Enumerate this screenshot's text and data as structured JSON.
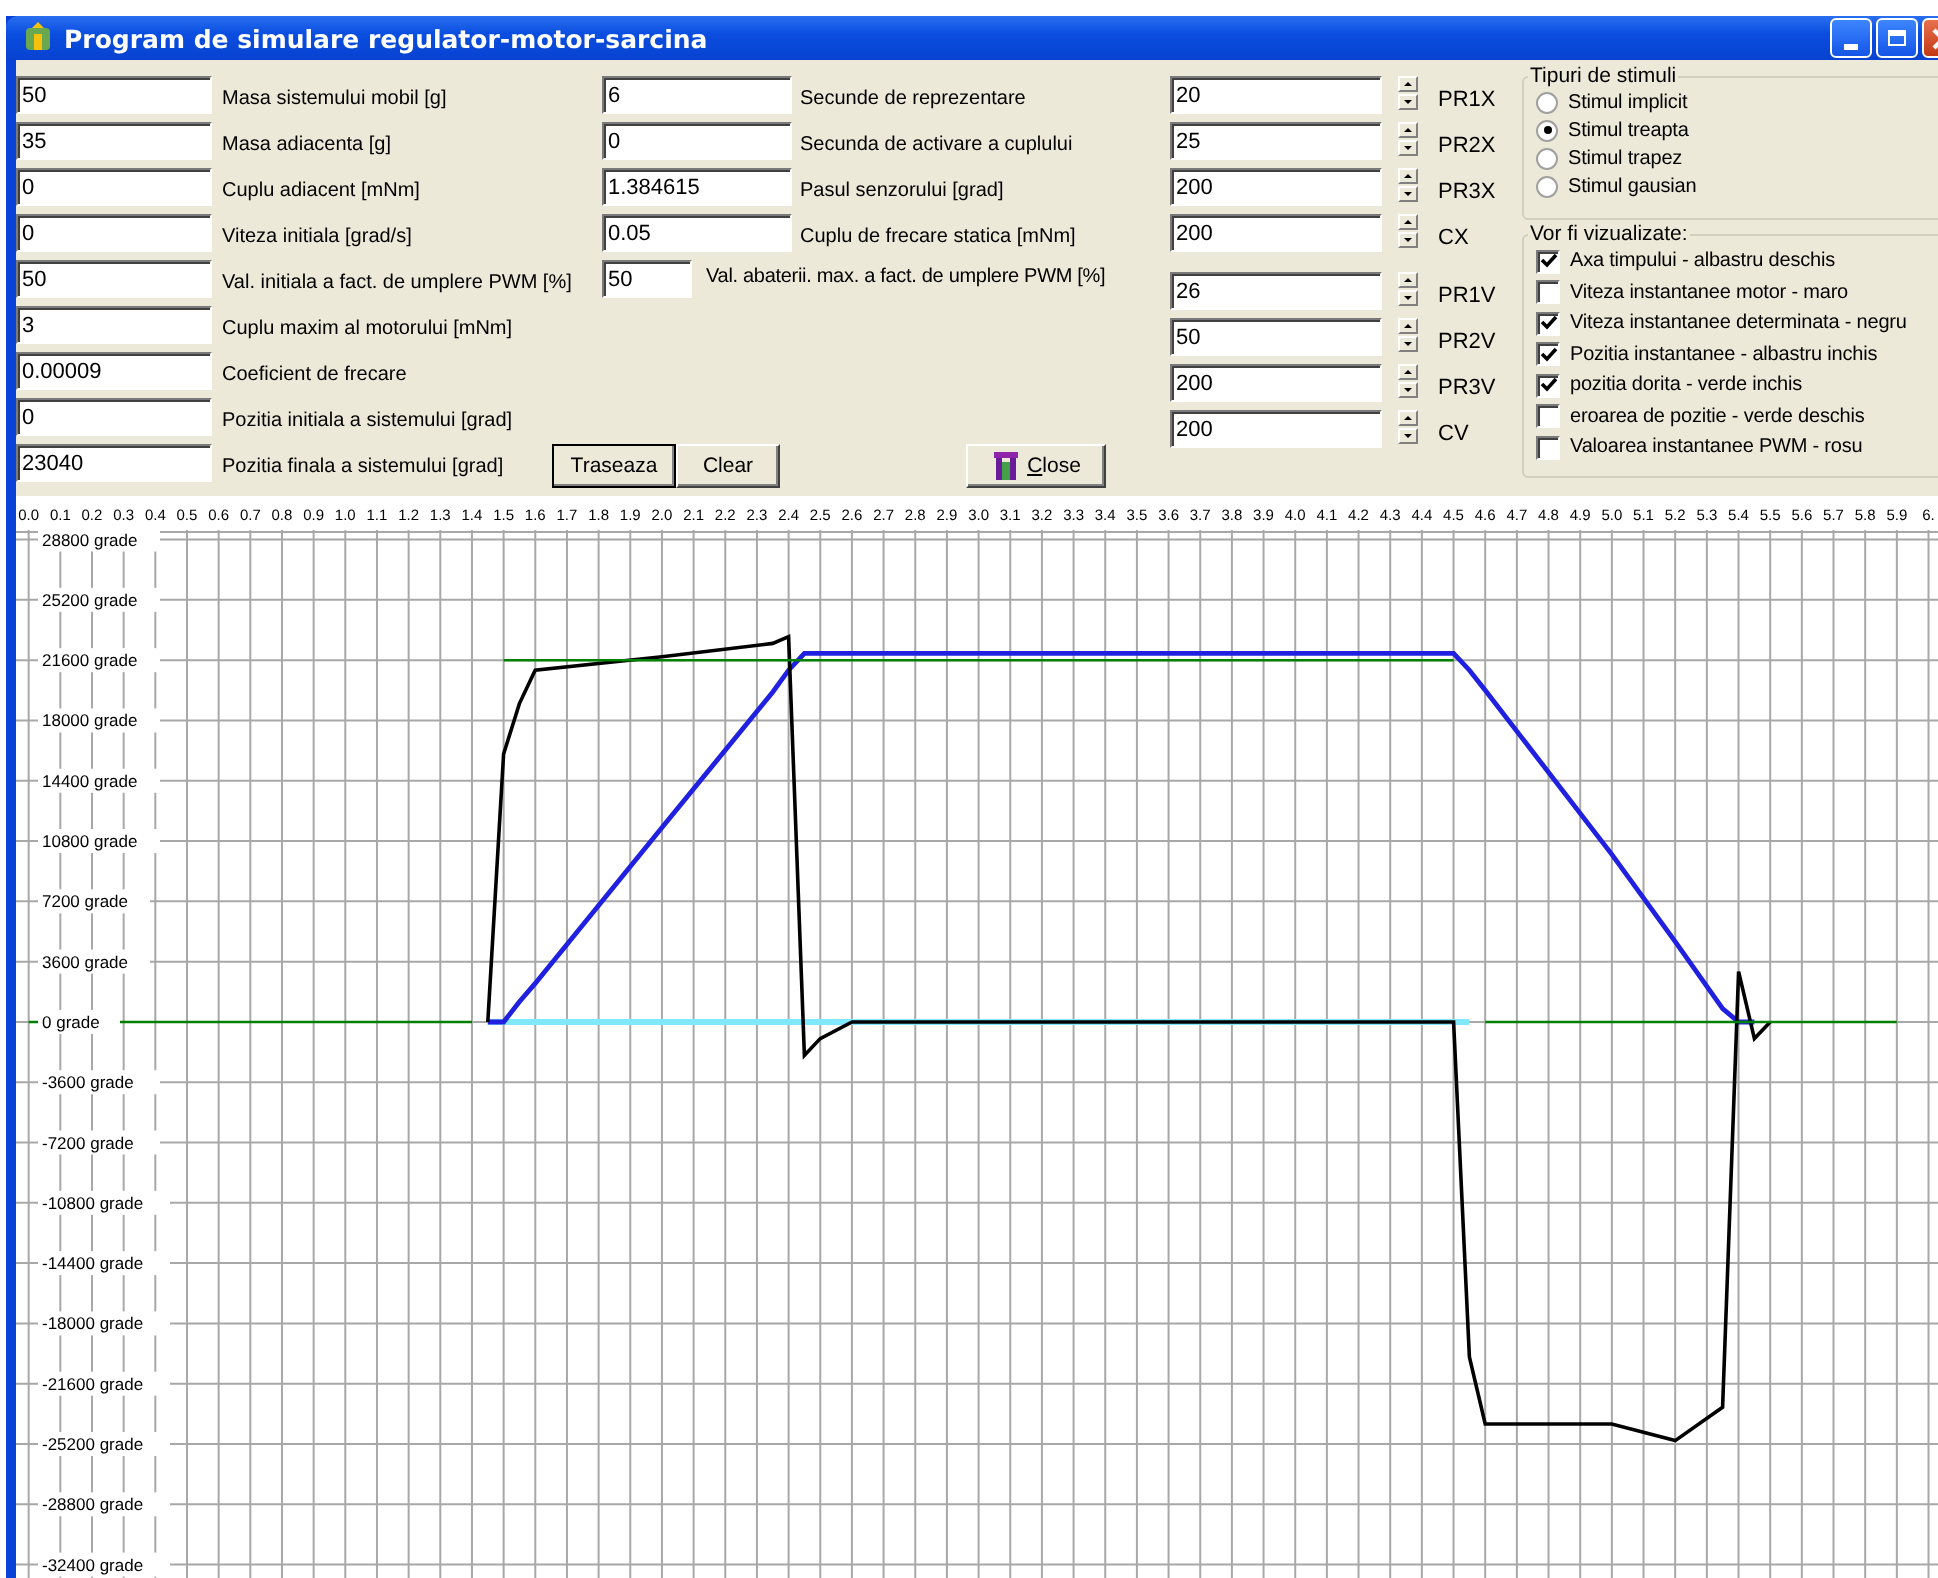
{
  "window": {
    "title": "Program de simulare regulator-motor-sarcina"
  },
  "parameters": [
    {
      "value": "50",
      "label": "Masa sistemului mobil [g]"
    },
    {
      "value": "35",
      "label": "Masa adiacenta [g]"
    },
    {
      "value": "0",
      "label": "Cuplu adiacent [mNm]"
    },
    {
      "value": "0",
      "label": "Viteza initiala [grad/s]"
    },
    {
      "value": "50",
      "label": "Val. initiala a fact. de umplere PWM [%]"
    },
    {
      "value": "3",
      "label": "Cuplu maxim al motorului [mNm]"
    },
    {
      "value": "0.00009",
      "label": "Coeficient de frecare"
    },
    {
      "value": "0",
      "label": "Pozitia initiala a sistemului [grad]"
    },
    {
      "value": "23040",
      "label": "Pozitia finala a sistemului [grad]"
    }
  ],
  "parameters_2": [
    {
      "kind": "wide",
      "value": "6",
      "label": "Secunde de reprezentare"
    },
    {
      "kind": "wide",
      "value": "0",
      "label": "Secunda de activare a cuplului"
    },
    {
      "kind": "wide",
      "value": "1.384615",
      "label": "Pasul senzorului [grad]"
    },
    {
      "kind": "wide",
      "value": "0.05",
      "label": "Cuplu de frecare statica [mNm]"
    },
    {
      "kind": "narrow",
      "value": "50",
      "label": "Val. abaterii. max. a fact. de umplere PWM [%]"
    }
  ],
  "buttons": [
    {
      "label": "Traseaza",
      "focused": true
    },
    {
      "label": "Clear",
      "focused": false
    }
  ],
  "close_button": {
    "label": "Close"
  },
  "position_tuning": [
    {
      "value": "20",
      "label": "PR1X"
    },
    {
      "value": "25",
      "label": "PR2X"
    },
    {
      "value": "200",
      "label": "PR3X"
    },
    {
      "value": "200",
      "label": "CX"
    }
  ],
  "velocity_tuning": [
    {
      "value": "26",
      "label": "PR1V"
    },
    {
      "value": "50",
      "label": "PR2V"
    },
    {
      "value": "200",
      "label": "PR3V"
    },
    {
      "value": "200",
      "label": "CV"
    }
  ],
  "stimulus_types": {
    "title": "Tipuri de stimuli",
    "options": [
      {
        "label": "Stimul implicit",
        "selected": false
      },
      {
        "label": "Stimul treapta",
        "selected": true
      },
      {
        "label": "Stimul trapez",
        "selected": false
      },
      {
        "label": "Stimul gausian",
        "selected": false
      }
    ]
  },
  "display": {
    "title": "Vor fi vizualizate:",
    "options": [
      {
        "label": "Axa timpului - albastru deschis",
        "checked": true
      },
      {
        "label": "Viteza instantanee motor - maro",
        "checked": false
      },
      {
        "label": "Viteza instantanee determinata - negru",
        "checked": true
      },
      {
        "label": "Pozitia instantanee - albastru inchis",
        "checked": true
      },
      {
        "label": "pozitia dorita - verde inchis",
        "checked": true
      },
      {
        "label": "eroarea de pozitie - verde deschis",
        "checked": false
      },
      {
        "label": "Valoarea instantanee PWM - rosu",
        "checked": false
      }
    ]
  },
  "plot": {
    "chart_data": {
      "type": "line",
      "x": [
        0,
        1.4,
        1.45,
        1.5,
        1.55,
        1.6,
        2.0,
        2.35,
        2.4,
        2.45,
        2.5,
        2.6,
        4.4,
        4.5,
        4.55,
        4.6,
        5.0,
        5.2,
        5.35,
        5.4,
        5.45,
        5.5,
        5.9
      ],
      "xlim": [
        -0.04,
        6.03
      ],
      "ylim": [
        -33200,
        31400
      ],
      "grid": true,
      "series": [
        {
          "color": "#80e8ff",
          "line_style": "solid",
          "values": [
            null,
            null,
            0,
            0,
            0,
            0,
            0,
            0,
            0,
            0,
            0,
            0,
            0,
            0,
            0,
            null,
            null,
            null,
            null,
            null,
            null,
            null,
            null
          ]
        },
        {
          "color": "#2020e0",
          "line_style": "solid",
          "values": [
            null,
            null,
            0,
            0,
            1200,
            2300,
            11600,
            19700,
            21000,
            22000,
            22000,
            22000,
            22000,
            22000,
            21000,
            19800,
            10000,
            4800,
            800,
            0,
            0,
            null,
            null
          ]
        },
        {
          "color": "#000000",
          "line_style": "solid",
          "values": [
            null,
            null,
            0,
            16000,
            19000,
            21000,
            21800,
            22600,
            23000,
            -2000,
            -1000,
            0,
            0,
            0,
            -20000,
            -24000,
            -24000,
            -25000,
            -23000,
            3000,
            -1000,
            0,
            null
          ]
        },
        {
          "color": "#008000",
          "line_style": "solid",
          "values": [
            0,
            0,
            null,
            21600,
            21600,
            21600,
            21600,
            21600,
            21600,
            21600,
            21600,
            21600,
            21600,
            21600,
            null,
            0,
            0,
            0,
            0,
            0,
            0,
            0,
            0
          ]
        }
      ],
      "xticks": [
        {
          "value": 0,
          "label": "0.0"
        },
        0.1,
        0.2,
        0.3,
        0.4,
        0.5,
        0.6,
        0.7,
        0.8,
        0.9,
        {
          "value": 1,
          "label": "1.0"
        },
        1.1,
        1.2,
        1.3,
        1.4,
        1.5,
        1.6,
        1.7,
        1.8,
        1.9,
        {
          "value": 2,
          "label": "2.0"
        },
        2.1,
        2.2,
        2.3,
        2.4,
        2.5,
        2.6,
        2.7,
        2.8,
        2.9,
        {
          "value": 3,
          "label": "3.0"
        },
        3.1,
        3.2,
        3.3,
        3.4,
        3.5,
        3.6,
        3.7,
        3.8,
        3.9,
        {
          "value": 4,
          "label": "4.0"
        },
        4.1,
        4.2,
        4.3,
        4.4,
        4.5,
        4.6,
        4.7,
        4.8,
        4.9,
        {
          "value": 5,
          "label": "5.0"
        },
        5.1,
        5.2,
        5.3,
        5.4,
        5.5,
        5.6,
        5.7,
        5.8,
        5.9,
        {
          "value": 6,
          "label": "6."
        }
      ],
      "yticks": [
        {
          "value": 28800,
          "label": "28800 grade"
        },
        {
          "value": 25200,
          "label": "25200 grade"
        },
        {
          "value": 21600,
          "label": "21600 grade"
        },
        {
          "value": 18000,
          "label": "18000 grade"
        },
        {
          "value": 14400,
          "label": "14400 grade"
        },
        {
          "value": 10800,
          "label": "10800 grade"
        },
        {
          "value": 7200,
          "label": "7200 grade"
        },
        {
          "value": 3600,
          "label": "3600 grade"
        },
        {
          "value": 0,
          "label": "0 grade"
        },
        {
          "value": -3600,
          "label": "-3600 grade"
        },
        {
          "value": -7200,
          "label": "-7200 grade"
        },
        {
          "value": -10800,
          "label": "-10800 grade"
        },
        {
          "value": -14400,
          "label": "-14400 grade"
        },
        {
          "value": -18000,
          "label": "-18000 grade"
        },
        {
          "value": -21600,
          "label": "-21600 grade"
        },
        {
          "value": -25200,
          "label": "-25200 grade"
        },
        {
          "value": -28800,
          "label": "-28800 grade"
        },
        {
          "value": -32400,
          "label": "-32400 grade"
        }
      ]
    }
  }
}
